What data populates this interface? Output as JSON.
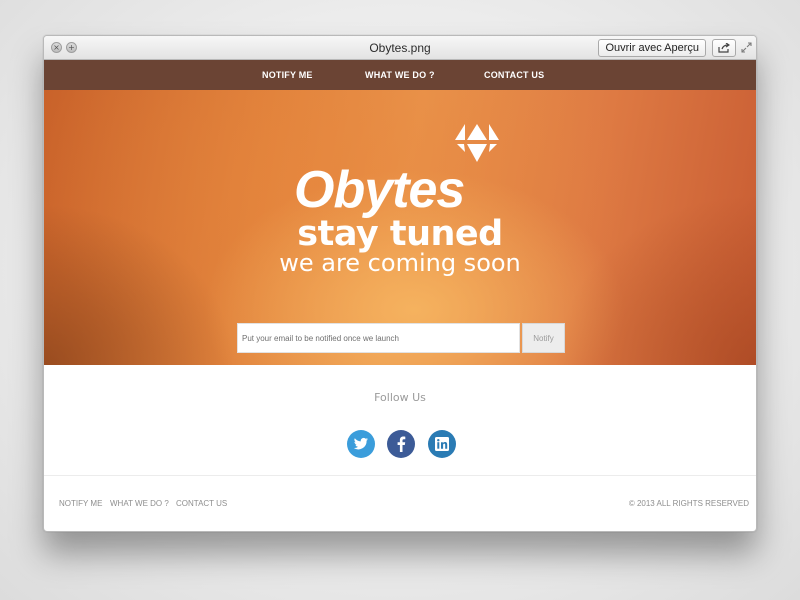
{
  "window": {
    "title": "Obytes.png",
    "open_button_label": "Ouvrir avec Aperçu",
    "share_icon": "share-icon",
    "fullscreen_icon": "fullscreen-icon"
  },
  "top_nav": {
    "items": [
      {
        "label": "NOTIFY ME"
      },
      {
        "label": "WHAT WE DO ?"
      },
      {
        "label": "CONTACT US"
      }
    ]
  },
  "hero": {
    "logo_text": "Obytes",
    "title": "stay tuned",
    "subtitle": "we are coming soon",
    "email_placeholder": "Put your email to be notified once we launch",
    "notify_button": "Notify"
  },
  "follow": {
    "title": "Follow Us",
    "networks": [
      {
        "name": "twitter",
        "icon": "twitter-icon",
        "color": "#3b9ddb"
      },
      {
        "name": "facebook",
        "icon": "facebook-icon",
        "color": "#3c5b97"
      },
      {
        "name": "linkedin",
        "icon": "linkedin-icon",
        "color": "#2a7bb4"
      }
    ]
  },
  "footer": {
    "links": [
      {
        "label": "NOTIFY ME"
      },
      {
        "label": "WHAT WE DO ?"
      },
      {
        "label": "CONTACT US"
      }
    ],
    "copyright": "© 2013 ALL RIGHTS RESERVED"
  },
  "colors": {
    "nav_background": "#6b4434",
    "hero_orange": "#e0823c",
    "hero_highlight": "#f6b460",
    "text_muted": "#9b9b9b"
  }
}
